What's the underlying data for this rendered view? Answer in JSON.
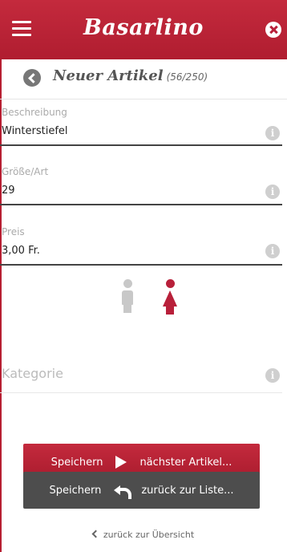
{
  "header": {
    "logo_text": "Basarlino",
    "menu_icon": "hamburger-icon",
    "close_icon": "close-icon"
  },
  "title": {
    "text": "Neuer Artikel",
    "count": "(56/250)"
  },
  "fields": [
    {
      "label": "Beschreibung",
      "value": "Winterstiefel"
    },
    {
      "label": "Größe/Art",
      "value": "29"
    },
    {
      "label": "Preis",
      "value": "3,00 Fr."
    }
  ],
  "gender": {
    "selected": "female",
    "colors": {
      "inactive": "#c8c8c8",
      "active": "#b8203a"
    }
  },
  "category": {
    "placeholder": "Kategorie"
  },
  "buttons": {
    "save_next_left": "Speichern",
    "save_next_right": "nächster Artikel...",
    "save_list_left": "Speichern",
    "save_list_right": "zurück zur Liste..."
  },
  "footer": {
    "back_link": "zurück zur Übersicht"
  },
  "colors": {
    "brand": "#b8203a",
    "dark_button": "#4d4d4d"
  }
}
